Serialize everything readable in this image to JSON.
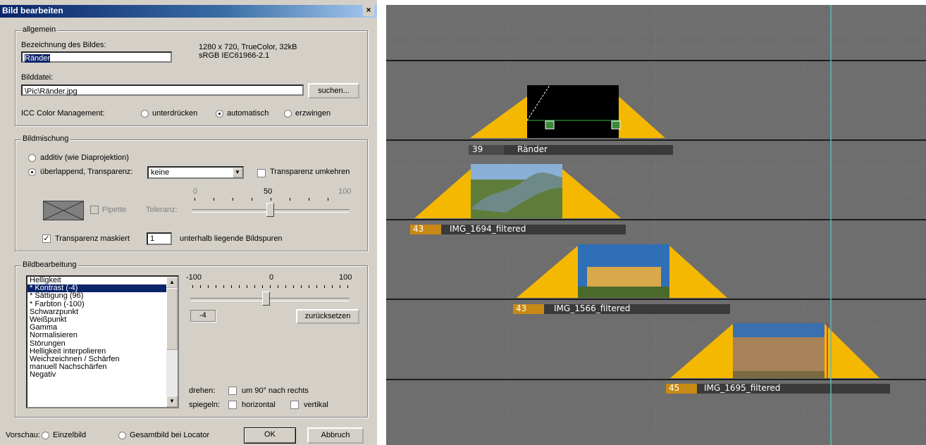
{
  "dialog": {
    "title": "Bild bearbeiten",
    "close_glyph": "×",
    "allgemein": {
      "legend": "allgemein",
      "name_label": "Bezeichnung des Bildes:",
      "name_value": "Ränder",
      "info_line1": "1280 x 720, TrueColor, 32kB",
      "info_line2": "sRGB IEC61966-2.1",
      "file_label": "Bilddatei:",
      "file_value": "\\Pic\\Ränder.jpg",
      "search_button": "suchen...",
      "icc_label": "ICC Color Management:",
      "icc_options": [
        "unterdrücken",
        "automatisch",
        "erzwingen"
      ],
      "icc_selected": "automatisch"
    },
    "mischung": {
      "legend": "Bildmischung",
      "additiv_label": "additiv (wie Diaprojektion)",
      "ueberlappend_label": "überlappend, Transparenz:",
      "transparenz_value": "keine",
      "invert_label": "Transparenz umkehren",
      "pipette_label": "Pipette",
      "toleranz_label": "Toleranz:",
      "tol_tick_0": "0",
      "tol_tick_50": "50",
      "tol_tick_100": "100",
      "toleranz_value": 50,
      "masked_label": "Transparenz maskiert",
      "masked_value": "1",
      "masked_suffix": "unterhalb liegende Bildspuren"
    },
    "bearbeitung": {
      "legend": "Bildbearbeitung",
      "items": [
        "Helligkeit",
        "* Kontrast (-4)",
        "* Sättigung (96)",
        "* Farbton (-100)",
        "Schwarzpunkt",
        "Weißpunkt",
        "Gamma",
        "Normalisieren",
        "Störungen",
        "Helligkeit interpolieren",
        "Weichzeichnen / Schärfen",
        "manuell Nachschärfen",
        "Negativ"
      ],
      "selected_index": 1,
      "tick_min": "-100",
      "tick_mid": "0",
      "tick_max": "100",
      "slider_value": -4,
      "value_display": "-4",
      "reset_button": "zurücksetzen",
      "drehen_label": "drehen:",
      "rotate_label": "um 90° nach rechts",
      "spiegeln_label": "spiegeln:",
      "horizontal_label": "horizontal",
      "vertikal_label": "vertikal"
    },
    "footer": {
      "vorschau_label": "Vorschau:",
      "einzelbild_label": "Einzelbild",
      "gesamtbild_label": "Gesamtbild bei Locator",
      "ok_button": "OK",
      "cancel_button": "Abbruch"
    }
  },
  "timeline": {
    "clips": [
      {
        "number": "39",
        "name": "Ränder"
      },
      {
        "number": "43",
        "name": "IMG_1694_filtered"
      },
      {
        "number": "43",
        "name": "IMG_1566_filtered"
      },
      {
        "number": "45",
        "name": "IMG_1695_filtered"
      }
    ],
    "colors": {
      "background": "#6e6e6e",
      "fade": "#f5b800",
      "bar_dark": "#3a3a3a",
      "number_bg": "#c88a14",
      "locator": "#5fb8b0"
    }
  }
}
